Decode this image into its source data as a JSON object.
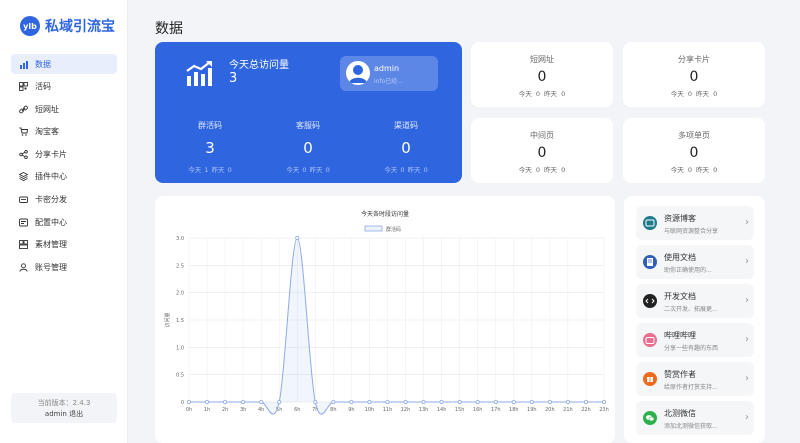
{
  "app": {
    "logo_badge": "ylb",
    "logo_text": "私域引流宝"
  },
  "sidebar": {
    "items": [
      {
        "label": "数据",
        "icon": "chart-icon",
        "active": true
      },
      {
        "label": "活码",
        "icon": "qrcode-icon"
      },
      {
        "label": "短网址",
        "icon": "link-icon"
      },
      {
        "label": "淘宝客",
        "icon": "cart-icon"
      },
      {
        "label": "分享卡片",
        "icon": "share-icon"
      },
      {
        "label": "插件中心",
        "icon": "stack-icon"
      },
      {
        "label": "卡密分发",
        "icon": "ticket-icon"
      },
      {
        "label": "配置中心",
        "icon": "config-icon"
      },
      {
        "label": "素材管理",
        "icon": "folder-icon"
      },
      {
        "label": "账号管理",
        "icon": "user-icon"
      }
    ],
    "version_label": "当前版本：2.4.3",
    "user_label": "admin 退出"
  },
  "page_title": "数据",
  "hero": {
    "label": "今天总访问量",
    "total": "3",
    "admin_name": "admin",
    "admin_sub": "info已经...",
    "stats": [
      {
        "label": "群活码",
        "value": "3",
        "sub": "今天 1  昨天 0"
      },
      {
        "label": "客服码",
        "value": "0",
        "sub": "今天 0  昨天 0"
      },
      {
        "label": "渠道码",
        "value": "0",
        "sub": "今天 0  昨天 0"
      }
    ]
  },
  "mini_cards": [
    {
      "label": "短网址",
      "value": "0",
      "sub": "今天 0  昨天 0"
    },
    {
      "label": "分享卡片",
      "value": "0",
      "sub": "今天 0  昨天 0"
    },
    {
      "label": "中间页",
      "value": "0",
      "sub": "今天 0  昨天 0"
    },
    {
      "label": "多项单页",
      "value": "0",
      "sub": "今天 0  昨天 0"
    }
  ],
  "links": [
    {
      "title": "资源博客",
      "desc": "与联网资源整合分享",
      "icon": "blog-icon",
      "color": "#1f7a8c"
    },
    {
      "title": "使用文档",
      "desc": "助你正确使用的...",
      "icon": "doc-icon",
      "color": "#2f5fb8"
    },
    {
      "title": "开发文档",
      "desc": "二次开发、拓展更...",
      "icon": "code-icon",
      "color": "#222222"
    },
    {
      "title": "哔哩哔哩",
      "desc": "分享一些有趣的东西",
      "icon": "bilibili-icon",
      "color": "#e86f8f"
    },
    {
      "title": "赞赏作者",
      "desc": "给原作者打赏支持...",
      "icon": "gift-icon",
      "color": "#ee6a1c"
    },
    {
      "title": "北测微信",
      "desc": "添加北测微信获取...",
      "icon": "wechat-icon",
      "color": "#2bb24c"
    }
  ],
  "chart_data": {
    "type": "line",
    "title": "今天各时段访问量",
    "ylabel": "访问量",
    "xlabel": "",
    "x": [
      "0h",
      "1h",
      "2h",
      "3h",
      "4h",
      "5h",
      "6h",
      "7h",
      "8h",
      "9h",
      "10h",
      "11h",
      "12h",
      "13h",
      "14h",
      "15h",
      "16h",
      "17h",
      "18h",
      "19h",
      "20h",
      "21h",
      "22h",
      "23h"
    ],
    "series": [
      {
        "name": "群活码",
        "values": [
          0,
          0,
          0,
          0,
          0,
          0,
          3,
          0,
          0,
          0,
          0,
          0,
          0,
          0,
          0,
          0,
          0,
          0,
          0,
          0,
          0,
          0,
          0,
          0
        ]
      }
    ],
    "ylim": [
      0,
      3
    ],
    "yticks": [
      "0",
      "0.5",
      "1.0",
      "1.5",
      "2.0",
      "2.5",
      "3.0"
    ],
    "grid": true,
    "legend": "top-center",
    "color": "#8fa9e8"
  }
}
